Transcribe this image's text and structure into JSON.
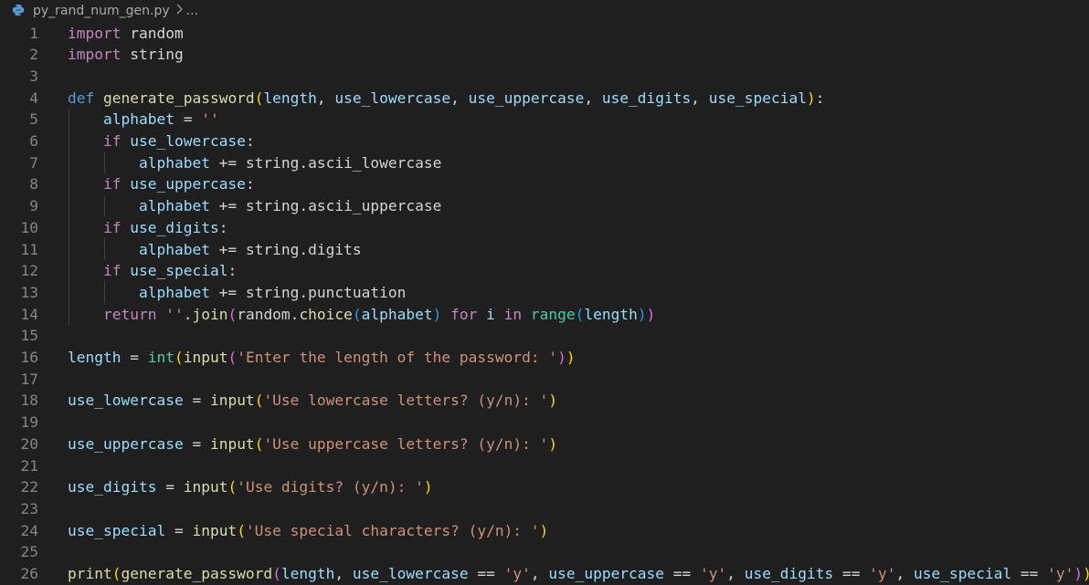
{
  "breadcrumb": {
    "file_name": "py_rand_num_gen.py",
    "trailing": "..."
  },
  "icons": {
    "file_icon": "python-file-icon",
    "separator_icon": "chevron-right-icon"
  },
  "colors": {
    "background": "#1f1f1f",
    "line_number": "#858585",
    "keyword_control": "#c586c0",
    "keyword_def": "#569cd6",
    "function": "#dcdcaa",
    "variable": "#9cdcfe",
    "string": "#ce9178",
    "builtin": "#4ec9b0",
    "bracket_1": "#ffd700",
    "bracket_2": "#da70d6",
    "bracket_3": "#179fff"
  },
  "lines": [
    {
      "n": "1",
      "tokens": [
        [
          "kw-import",
          "import"
        ],
        [
          "plain",
          " random"
        ]
      ]
    },
    {
      "n": "2",
      "tokens": [
        [
          "kw-import",
          "import"
        ],
        [
          "plain",
          " string"
        ]
      ]
    },
    {
      "n": "3",
      "tokens": []
    },
    {
      "n": "4",
      "tokens": [
        [
          "kw-def",
          "def"
        ],
        [
          "plain",
          " "
        ],
        [
          "fn",
          "generate_password"
        ],
        [
          "br1",
          "("
        ],
        [
          "param",
          "length"
        ],
        [
          "plain",
          ", "
        ],
        [
          "param",
          "use_lowercase"
        ],
        [
          "plain",
          ", "
        ],
        [
          "param",
          "use_uppercase"
        ],
        [
          "plain",
          ", "
        ],
        [
          "param",
          "use_digits"
        ],
        [
          "plain",
          ", "
        ],
        [
          "param",
          "use_special"
        ],
        [
          "br1",
          ")"
        ],
        [
          "plain",
          ":"
        ]
      ]
    },
    {
      "n": "5",
      "tokens": [
        [
          "plain",
          "    "
        ],
        [
          "var",
          "alphabet"
        ],
        [
          "op",
          " = "
        ],
        [
          "str",
          "''"
        ]
      ]
    },
    {
      "n": "6",
      "tokens": [
        [
          "plain",
          "    "
        ],
        [
          "kw-ctrl",
          "if"
        ],
        [
          "plain",
          " "
        ],
        [
          "var",
          "use_lowercase"
        ],
        [
          "plain",
          ":"
        ]
      ]
    },
    {
      "n": "7",
      "tokens": [
        [
          "plain",
          "        "
        ],
        [
          "var",
          "alphabet"
        ],
        [
          "op",
          " += "
        ],
        [
          "plain",
          "string.ascii_lowercase"
        ]
      ]
    },
    {
      "n": "8",
      "tokens": [
        [
          "plain",
          "    "
        ],
        [
          "kw-ctrl",
          "if"
        ],
        [
          "plain",
          " "
        ],
        [
          "var",
          "use_uppercase"
        ],
        [
          "plain",
          ":"
        ]
      ]
    },
    {
      "n": "9",
      "tokens": [
        [
          "plain",
          "        "
        ],
        [
          "var",
          "alphabet"
        ],
        [
          "op",
          " += "
        ],
        [
          "plain",
          "string.ascii_uppercase"
        ]
      ]
    },
    {
      "n": "10",
      "tokens": [
        [
          "plain",
          "    "
        ],
        [
          "kw-ctrl",
          "if"
        ],
        [
          "plain",
          " "
        ],
        [
          "var",
          "use_digits"
        ],
        [
          "plain",
          ":"
        ]
      ]
    },
    {
      "n": "11",
      "tokens": [
        [
          "plain",
          "        "
        ],
        [
          "var",
          "alphabet"
        ],
        [
          "op",
          " += "
        ],
        [
          "plain",
          "string.digits"
        ]
      ]
    },
    {
      "n": "12",
      "tokens": [
        [
          "plain",
          "    "
        ],
        [
          "kw-ctrl",
          "if"
        ],
        [
          "plain",
          " "
        ],
        [
          "var",
          "use_special"
        ],
        [
          "plain",
          ":"
        ]
      ]
    },
    {
      "n": "13",
      "tokens": [
        [
          "plain",
          "        "
        ],
        [
          "var",
          "alphabet"
        ],
        [
          "op",
          " += "
        ],
        [
          "plain",
          "string.punctuation"
        ]
      ]
    },
    {
      "n": "14",
      "tokens": [
        [
          "plain",
          "    "
        ],
        [
          "kw-ctrl",
          "return"
        ],
        [
          "plain",
          " "
        ],
        [
          "str",
          "''"
        ],
        [
          "plain",
          "."
        ],
        [
          "fn",
          "join"
        ],
        [
          "br2",
          "("
        ],
        [
          "plain",
          "random."
        ],
        [
          "fn",
          "choice"
        ],
        [
          "br3",
          "("
        ],
        [
          "var",
          "alphabet"
        ],
        [
          "br3",
          ")"
        ],
        [
          "plain",
          " "
        ],
        [
          "kw-ctrl",
          "for"
        ],
        [
          "plain",
          " "
        ],
        [
          "var",
          "i"
        ],
        [
          "plain",
          " "
        ],
        [
          "kw-ctrl",
          "in"
        ],
        [
          "plain",
          " "
        ],
        [
          "builtin",
          "range"
        ],
        [
          "br3",
          "("
        ],
        [
          "var",
          "length"
        ],
        [
          "br3",
          ")"
        ],
        [
          "br2",
          ")"
        ]
      ]
    },
    {
      "n": "15",
      "tokens": []
    },
    {
      "n": "16",
      "tokens": [
        [
          "var",
          "length"
        ],
        [
          "op",
          " = "
        ],
        [
          "builtin",
          "int"
        ],
        [
          "br1",
          "("
        ],
        [
          "fn",
          "input"
        ],
        [
          "br2",
          "("
        ],
        [
          "str",
          "'Enter the length of the password: '"
        ],
        [
          "br2",
          ")"
        ],
        [
          "br1",
          ")"
        ]
      ]
    },
    {
      "n": "17",
      "tokens": []
    },
    {
      "n": "18",
      "tokens": [
        [
          "var",
          "use_lowercase"
        ],
        [
          "op",
          " = "
        ],
        [
          "fn",
          "input"
        ],
        [
          "br1",
          "("
        ],
        [
          "str",
          "'Use lowercase letters? (y/n): '"
        ],
        [
          "br1",
          ")"
        ]
      ]
    },
    {
      "n": "19",
      "tokens": []
    },
    {
      "n": "20",
      "tokens": [
        [
          "var",
          "use_uppercase"
        ],
        [
          "op",
          " = "
        ],
        [
          "fn",
          "input"
        ],
        [
          "br1",
          "("
        ],
        [
          "str",
          "'Use uppercase letters? (y/n): '"
        ],
        [
          "br1",
          ")"
        ]
      ]
    },
    {
      "n": "21",
      "tokens": []
    },
    {
      "n": "22",
      "tokens": [
        [
          "var",
          "use_digits"
        ],
        [
          "op",
          " = "
        ],
        [
          "fn",
          "input"
        ],
        [
          "br1",
          "("
        ],
        [
          "str",
          "'Use digits? (y/n): '"
        ],
        [
          "br1",
          ")"
        ]
      ]
    },
    {
      "n": "23",
      "tokens": []
    },
    {
      "n": "24",
      "tokens": [
        [
          "var",
          "use_special"
        ],
        [
          "op",
          " = "
        ],
        [
          "fn",
          "input"
        ],
        [
          "br1",
          "("
        ],
        [
          "str",
          "'Use special characters? (y/n): '"
        ],
        [
          "br1",
          ")"
        ]
      ]
    },
    {
      "n": "25",
      "tokens": []
    },
    {
      "n": "26",
      "tokens": [
        [
          "fn",
          "print"
        ],
        [
          "br1",
          "("
        ],
        [
          "fn",
          "generate_password"
        ],
        [
          "br2",
          "("
        ],
        [
          "var",
          "length"
        ],
        [
          "plain",
          ", "
        ],
        [
          "var",
          "use_lowercase"
        ],
        [
          "op",
          " == "
        ],
        [
          "str",
          "'y'"
        ],
        [
          "plain",
          ", "
        ],
        [
          "var",
          "use_uppercase"
        ],
        [
          "op",
          " == "
        ],
        [
          "str",
          "'y'"
        ],
        [
          "plain",
          ", "
        ],
        [
          "var",
          "use_digits"
        ],
        [
          "op",
          " == "
        ],
        [
          "str",
          "'y'"
        ],
        [
          "plain",
          ", "
        ],
        [
          "var",
          "use_special"
        ],
        [
          "op",
          " == "
        ],
        [
          "str",
          "'y'"
        ],
        [
          "br2",
          ")"
        ],
        [
          "br1",
          ")"
        ]
      ]
    }
  ]
}
